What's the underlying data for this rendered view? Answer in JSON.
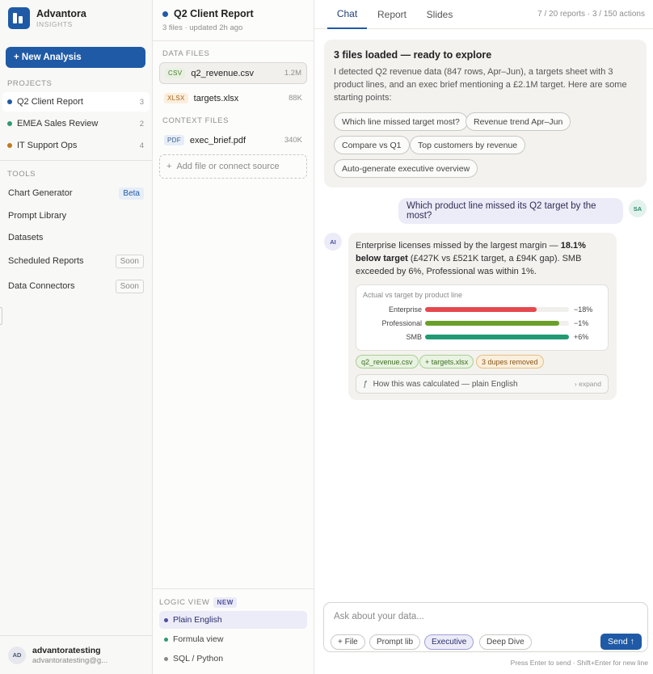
{
  "brand": {
    "name": "Advantora",
    "subtitle": "INSIGHTS"
  },
  "sidebar": {
    "new_analysis_label": "+ New Analysis",
    "projects_label": "PROJECTS",
    "projects": [
      {
        "name": "Q2 Client Report",
        "count": "3",
        "color": "#1f5aa6",
        "active": true
      },
      {
        "name": "EMEA Sales Review",
        "count": "2",
        "color": "#2e9b6f",
        "active": false
      },
      {
        "name": "IT Support Ops",
        "count": "4",
        "color": "#c07a1c",
        "active": false
      }
    ],
    "tools_label": "TOOLS",
    "tools": [
      {
        "name": "Chart Generator",
        "badge": "Beta"
      },
      {
        "name": "Prompt Library",
        "badge": ""
      },
      {
        "name": "Datasets",
        "badge": ""
      },
      {
        "name": "Scheduled Reports",
        "badge": "Soon"
      },
      {
        "name": "Data Connectors",
        "badge": "Soon"
      }
    ],
    "user": {
      "initials": "AD",
      "name": "advantoratesting",
      "email": "advantoratesting@g..."
    }
  },
  "files_panel": {
    "title": "Q2 Client Report",
    "meta": "3 files · updated 2h ago",
    "data_files_label": "DATA FILES",
    "data_files": [
      {
        "type": "CSV",
        "name": "q2_revenue.csv",
        "size": "1.2M"
      },
      {
        "type": "XLSX",
        "name": "targets.xlsx",
        "size": "88K"
      }
    ],
    "context_files_label": "CONTEXT FILES",
    "context_files": [
      {
        "type": "PDF",
        "name": "exec_brief.pdf",
        "size": "340K"
      }
    ],
    "add_source_label": "Add file or connect source",
    "logic_view": {
      "label": "LOGIC VIEW",
      "badge": "NEW",
      "options": [
        {
          "label": "Plain English",
          "color": "#4b4f9e"
        },
        {
          "label": "Formula view",
          "color": "#2e9b6f"
        },
        {
          "label": "SQL / Python",
          "color": "#8a8a8a"
        }
      ]
    }
  },
  "chat": {
    "tabs": [
      "Chat",
      "Report",
      "Slides"
    ],
    "usage": "7 / 20 reports · 3 / 150 actions",
    "welcome": {
      "title": "3 files loaded — ready to explore",
      "body": "I detected Q2 revenue data (847 rows, Apr–Jun), a targets sheet with 3 product lines, and an exec brief mentioning a £2.1M target. Here are some starting points:",
      "chips": [
        "Which line missed target most?",
        "Revenue trend Apr–Jun",
        "Compare vs Q1",
        "Top customers by revenue",
        "Auto-generate executive overview"
      ]
    },
    "user_message": {
      "initials": "SA",
      "text": "Which product line missed its Q2 target by the most?"
    },
    "ai_message": {
      "initials": "AI",
      "text_before": "Enterprise licenses missed by the largest margin — ",
      "text_bold": "18.1% below target",
      "text_after": " (£427K vs £521K target, a £94K gap). SMB exceeded by 6%, Professional was within 1%.",
      "tags": [
        "q2_revenue.csv",
        "+ targets.xlsx",
        "3 dupes removed"
      ],
      "calc_label": "How this was calculated — plain English",
      "calc_expand": "› expand"
    },
    "composer": {
      "placeholder": "Ask about your data...",
      "pills": [
        "+ File",
        "Prompt lib",
        "Executive",
        "Deep Dive"
      ],
      "send_label": "Send ↑",
      "hint": "Press Enter to send · Shift+Enter for new line"
    }
  },
  "chart_data": {
    "type": "bar",
    "title": "Actual vs target by product line",
    "categories": [
      "Enterprise",
      "Professional",
      "SMB"
    ],
    "values": [
      81.9,
      99,
      106
    ],
    "value_labels": [
      "−18%",
      "−1%",
      "+6%"
    ],
    "colors": [
      "#e5484d",
      "#6a9f2a",
      "#1f9a73"
    ],
    "ylim": [
      0,
      106
    ]
  }
}
